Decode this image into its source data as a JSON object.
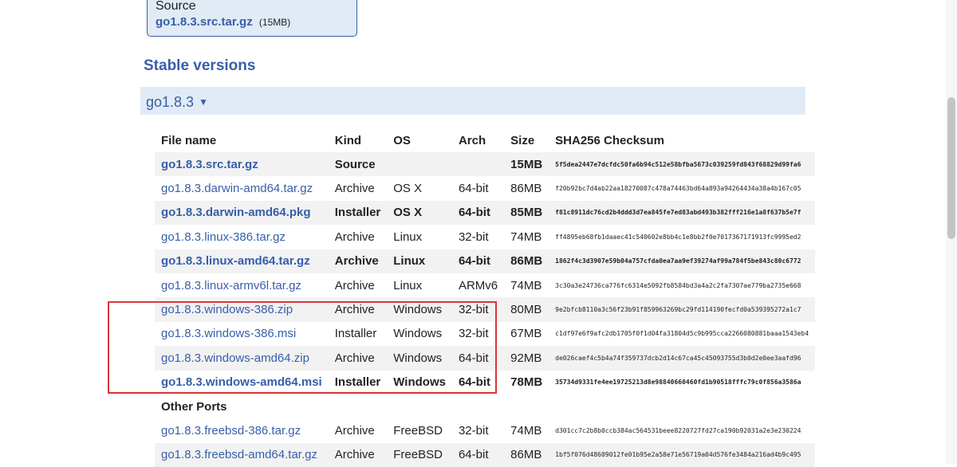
{
  "source_box": {
    "title": "Source",
    "file": "go1.8.3.src.tar.gz",
    "size": "(15MB)"
  },
  "section_title": "Stable versions",
  "version": {
    "label": "go1.8.3",
    "caret": "▼"
  },
  "table": {
    "headers": [
      "File name",
      "Kind",
      "OS",
      "Arch",
      "Size",
      "SHA256 Checksum"
    ],
    "rows": [
      {
        "file": "go1.8.3.src.tar.gz",
        "kind": "Source",
        "os": "",
        "arch": "",
        "size": "15MB",
        "sum": "5f5dea2447e7dcfdc50fa6b94c512e58bfba5673c039259fd843f68829d99fa6",
        "bold": true
      },
      {
        "file": "go1.8.3.darwin-amd64.tar.gz",
        "kind": "Archive",
        "os": "OS X",
        "arch": "64-bit",
        "size": "86MB",
        "sum": "f20b92bc7d4ab22aa18270087c478a74463bd64a893a94264434a38a4b167c05",
        "bold": false
      },
      {
        "file": "go1.8.3.darwin-amd64.pkg",
        "kind": "Installer",
        "os": "OS X",
        "arch": "64-bit",
        "size": "85MB",
        "sum": "f81c8911dc76cd2b4ddd3d7ea845fe7ed83abd493b382fff216e1a8f637b5e7f",
        "bold": true
      },
      {
        "file": "go1.8.3.linux-386.tar.gz",
        "kind": "Archive",
        "os": "Linux",
        "arch": "32-bit",
        "size": "74MB",
        "sum": "ff4895eb68fb1daaec41c540602e8bb4c1e8bb2f0e7017367171913fc9995ed2",
        "bold": false
      },
      {
        "file": "go1.8.3.linux-amd64.tar.gz",
        "kind": "Archive",
        "os": "Linux",
        "arch": "64-bit",
        "size": "86MB",
        "sum": "1862f4c3d3907e59b04a757cfda0ea7aa9ef39274af99a784f5be843c80c6772",
        "bold": true
      },
      {
        "file": "go1.8.3.linux-armv6l.tar.gz",
        "kind": "Archive",
        "os": "Linux",
        "arch": "ARMv6",
        "size": "74MB",
        "sum": "3c30a3e24736ca776fc6314e5092fb8584bd3a4a2c2fa7307ae779ba2735e668",
        "bold": false
      },
      {
        "file": "go1.8.3.windows-386.zip",
        "kind": "Archive",
        "os": "Windows",
        "arch": "32-bit",
        "size": "80MB",
        "sum": "9e2bfcb8110a3c56f23b91f859963269bc29fd114190fecfd0a539395272a1c7",
        "bold": false
      },
      {
        "file": "go1.8.3.windows-386.msi",
        "kind": "Installer",
        "os": "Windows",
        "arch": "32-bit",
        "size": "67MB",
        "sum": "c1df97e6f9afc2db1705f0f1d04fa31804d5c9b995cca2266080881baaa1543eb4",
        "bold": false
      },
      {
        "file": "go1.8.3.windows-amd64.zip",
        "kind": "Archive",
        "os": "Windows",
        "arch": "64-bit",
        "size": "92MB",
        "sum": "de026caef4c5b4a74f359737dcb2d14c67ca45c45093755d3b0d2e0ee3aafd96",
        "bold": false
      },
      {
        "file": "go1.8.3.windows-amd64.msi",
        "kind": "Installer",
        "os": "Windows",
        "arch": "64-bit",
        "size": "78MB",
        "sum": "35734d9331fe4ee19725213d8e98840660460fd1b90518fffc79c0f856a3586a",
        "bold": true
      }
    ],
    "other_ports_label": "Other Ports",
    "other_rows": [
      {
        "file": "go1.8.3.freebsd-386.tar.gz",
        "kind": "Archive",
        "os": "FreeBSD",
        "arch": "32-bit",
        "size": "74MB",
        "sum": "d301cc7c2b8b0ccb384ac564531beee8220727fd27ca190b92031a2e3e230224"
      },
      {
        "file": "go1.8.3.freebsd-amd64.tar.gz",
        "kind": "Archive",
        "os": "FreeBSD",
        "arch": "64-bit",
        "size": "86MB",
        "sum": "1bf5f076d48609012fe01b95e2a58e71e56719a04d576fe3484a216ad4b9c495"
      }
    ]
  },
  "colors": {
    "link": "#375eab",
    "header_bg": "#e0ebf5",
    "highlight_box": "#d9373a"
  }
}
